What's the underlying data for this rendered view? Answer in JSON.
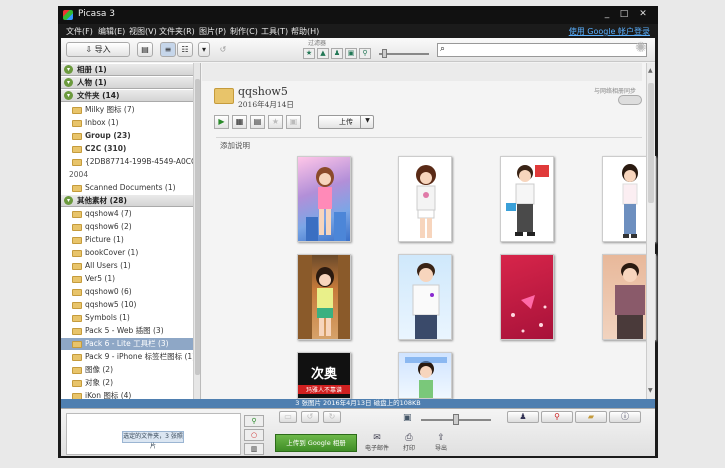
{
  "window": {
    "title": "Picasa 3",
    "controls": [
      "_",
      "□",
      "✕"
    ]
  },
  "menu": {
    "items": [
      "文件(F)",
      "编辑(E)",
      "视图(V)",
      "文件夹(R)",
      "图片(P)",
      "制作(C)",
      "工具(T)",
      "帮助(H)"
    ],
    "signin": "使用 Google 帐户登录"
  },
  "toolbar": {
    "import_label": "导入",
    "filter_label": "过滤器"
  },
  "sidebar": {
    "sections": [
      {
        "label": "相册 (1)"
      },
      {
        "label": "人物 (1)"
      },
      {
        "label": "文件夹 (14)"
      }
    ],
    "folders": [
      {
        "label": "Milky 图标 (7)",
        "bold": false
      },
      {
        "label": "Inbox (1)",
        "bold": false
      },
      {
        "label": "Group (23)",
        "bold": true
      },
      {
        "label": "C2C (310)",
        "bold": true
      },
      {
        "label": "{2DB87714-199B-4549-A0CC...",
        "bold": false
      }
    ],
    "year": "2004",
    "scanned": "Scanned Documents (1)",
    "other_section": "其他素材 (28)",
    "other_folders": [
      {
        "label": "qqshow4 (7)"
      },
      {
        "label": "qqshow6 (2)"
      },
      {
        "label": "Picture (1)"
      },
      {
        "label": "bookCover (1)"
      },
      {
        "label": "All Users (1)"
      },
      {
        "label": "Ver5 (1)"
      },
      {
        "label": "qqshow0 (6)"
      },
      {
        "label": "qqshow5 (10)"
      },
      {
        "label": "Symbols (1)"
      },
      {
        "label": "Pack 5 - Web 插图 (3)"
      },
      {
        "label": "Pack 6 - Lite 工具栏 (3)",
        "selected": true
      },
      {
        "label": "Pack 9 - iPhone 标签栏图标 (1)"
      },
      {
        "label": "图像 (2)"
      },
      {
        "label": "对象 (2)"
      },
      {
        "label": "iKon 图标 (4)"
      }
    ]
  },
  "album": {
    "name": "qqshow5",
    "date": "2016年4月14日",
    "sync_label": "与网络相册同步",
    "upload_label": "上传",
    "caption_placeholder": "添加说明",
    "thumb_texts": [
      "次奥",
      "玛雅人不靠谱"
    ]
  },
  "status": {
    "text": "3 张图片   2016年4月13日   磁盘上的108KB"
  },
  "bottom": {
    "tray_label": "选定的文件夹，3 张照片",
    "share_label": "上传到 Google 相册",
    "actions": [
      "电子邮件",
      "打印",
      "导出"
    ]
  }
}
